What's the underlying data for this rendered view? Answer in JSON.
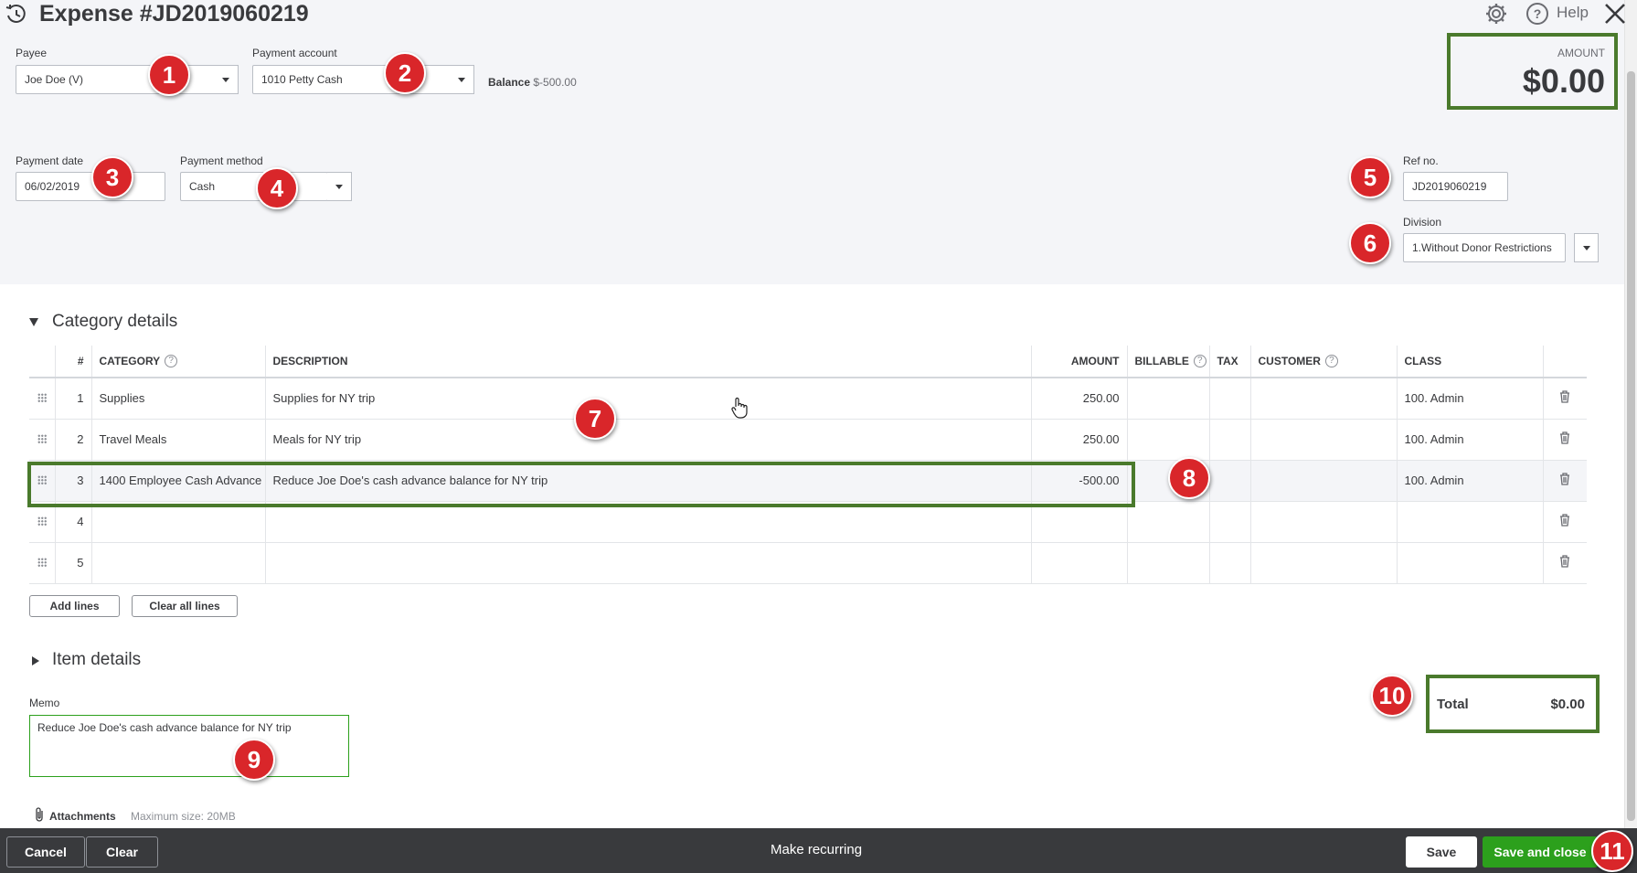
{
  "window": {
    "title": "Expense #JD2019060219",
    "help_label": "Help"
  },
  "header": {
    "payee": {
      "label": "Payee",
      "value": "Joe Doe (V)"
    },
    "payment_account": {
      "label": "Payment account",
      "value": "1010 Petty Cash"
    },
    "balance": {
      "label": "Balance",
      "value": "$-500.00"
    },
    "payment_date": {
      "label": "Payment date",
      "value": "06/02/2019"
    },
    "payment_method": {
      "label": "Payment method",
      "value": "Cash"
    },
    "ref_no": {
      "label": "Ref no.",
      "value": "JD2019060219"
    },
    "division": {
      "label": "Division",
      "value": "1.Without Donor Restrictions"
    },
    "amount": {
      "label": "AMOUNT",
      "value": "$0.00"
    }
  },
  "category_details": {
    "title": "Category details",
    "columns": {
      "num": "#",
      "category": "CATEGORY",
      "description": "DESCRIPTION",
      "amount": "AMOUNT",
      "billable": "BILLABLE",
      "tax": "TAX",
      "customer": "CUSTOMER",
      "class": "CLASS"
    },
    "rows": [
      {
        "num": "1",
        "category": "Supplies",
        "description": "Supplies for NY trip",
        "amount": "250.00",
        "class": "100. Admin"
      },
      {
        "num": "2",
        "category": "Travel Meals",
        "description": "Meals for NY trip",
        "amount": "250.00",
        "class": "100. Admin"
      },
      {
        "num": "3",
        "category": "1400 Employee Cash Advance",
        "description": "Reduce Joe Doe's cash advance balance for NY trip",
        "amount": "-500.00",
        "class": "100. Admin"
      },
      {
        "num": "4",
        "category": "",
        "description": "",
        "amount": "",
        "class": ""
      },
      {
        "num": "5",
        "category": "",
        "description": "",
        "amount": "",
        "class": ""
      }
    ],
    "add_lines": "Add lines",
    "clear_all_lines": "Clear all lines"
  },
  "item_details": {
    "title": "Item details"
  },
  "memo": {
    "label": "Memo",
    "value": "Reduce Joe Doe's cash advance balance for NY trip"
  },
  "attachments": {
    "label": "Attachments",
    "max_size": "Maximum size: 20MB"
  },
  "total": {
    "label": "Total",
    "value": "$0.00"
  },
  "footer": {
    "cancel": "Cancel",
    "clear": "Clear",
    "make_recurring": "Make recurring",
    "save": "Save",
    "save_and_close": "Save and close"
  },
  "annotations": [
    "1",
    "2",
    "3",
    "4",
    "5",
    "6",
    "7",
    "8",
    "9",
    "10",
    "11"
  ],
  "colors": {
    "accent_green": "#2ca01c",
    "highlight_border": "#4a7a2c",
    "badge_red": "#d9262a",
    "footer_bg": "#393a3d"
  }
}
